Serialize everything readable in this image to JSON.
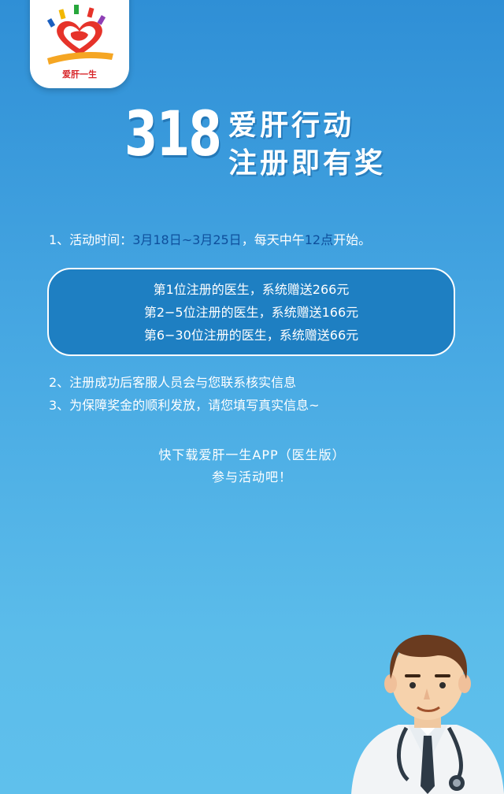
{
  "logo": {
    "text": "爱肝一生"
  },
  "headline": {
    "number": "318",
    "line1": "爱肝行动",
    "line2": "注册即有奖"
  },
  "item1": {
    "prefix": "1、活动时间：",
    "dates": "3月18日~3月25日",
    "mid": "，每天中午",
    "hour": "12点",
    "suffix": "开始。"
  },
  "prizes": [
    "第1位注册的医生，系统赠送266元",
    "第2−5位注册的医生，系统赠送166元",
    "第6−30位注册的医生，系统赠送66元"
  ],
  "item2": "2、注册成功后客服人员会与您联系核实信息",
  "item3": "3、为保障奖金的顺利发放，请您填写真实信息~",
  "cta": {
    "line1": "快下载爱肝一生APP（医生版）",
    "line2": "参与活动吧！"
  },
  "colors": {
    "background_top": "#2f8fd6",
    "background_bottom": "#5fc0ec",
    "highlight": "#0e4f9c",
    "box_fill": "#1e7fc2"
  }
}
